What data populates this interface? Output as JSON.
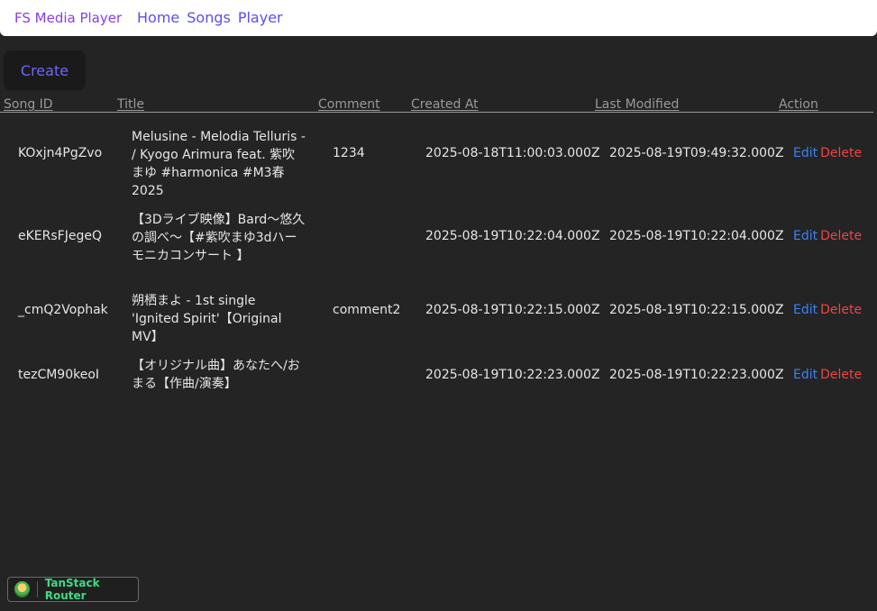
{
  "header": {
    "brand": "FS Media Player",
    "nav": [
      "Home",
      "Songs",
      "Player"
    ]
  },
  "actions": {
    "create_label": "Create"
  },
  "table": {
    "columns": [
      "Song ID",
      "Title",
      "Comment",
      "Created At",
      "Last Modified",
      "Action"
    ],
    "rows": [
      {
        "id": "KOxjn4PgZvo",
        "title": "Melusine - Melodia Telluris - / Kyogo Arimura feat. 紫吹まゆ #harmonica #M3春2025",
        "comment": "1234",
        "created": "2025-08-18T11:00:03.000Z",
        "modified": "2025-08-19T09:49:32.000Z"
      },
      {
        "id": "eKERsFJegeQ",
        "title": "【3Dライブ映像】Bard〜悠久の調べ〜【#紫吹まゆ3dハーモニカコンサート 】",
        "comment": "",
        "created": "2025-08-19T10:22:04.000Z",
        "modified": "2025-08-19T10:22:04.000Z"
      },
      {
        "id": "_cmQ2Vophak",
        "title": "朔栖まよ - 1st single 'Ignited Spirit'【Original MV】",
        "comment": "comment2",
        "created": "2025-08-19T10:22:15.000Z",
        "modified": "2025-08-19T10:22:15.000Z"
      },
      {
        "id": "tezCM90keoI",
        "title": "【オリジナル曲】あなたへ/おまる【作曲/演奏】",
        "comment": "",
        "created": "2025-08-19T10:22:23.000Z",
        "modified": "2025-08-19T10:22:23.000Z"
      }
    ],
    "edit_label": "Edit",
    "delete_label": "Delete"
  },
  "devtools": {
    "label": "TanStack Router"
  },
  "colors": {
    "background": "#242424",
    "brand": "#8a3cf0",
    "nav_link": "#5a4ff0",
    "edit": "#3b82f6",
    "delete": "#ef4444",
    "devtools_label": "#3ddc84"
  }
}
